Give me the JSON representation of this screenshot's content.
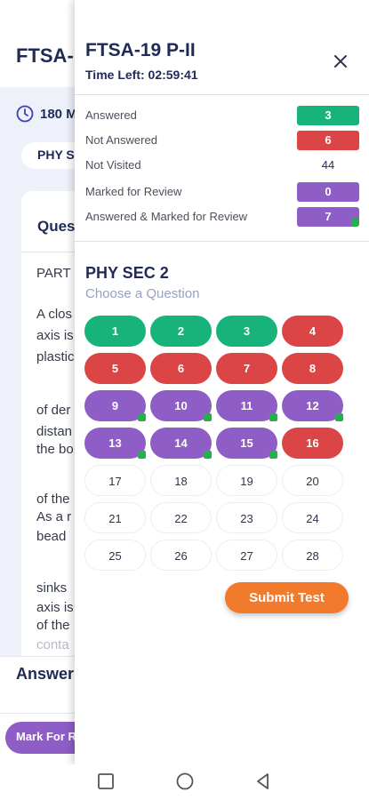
{
  "background": {
    "title": "FTSA-",
    "duration": "180 M",
    "section_pill": "PHY S",
    "card_title": "Ques",
    "text_lines": [
      "PART",
      "A clos",
      "axis is",
      "plastic",
      "of der",
      "distan",
      "the bo",
      "of the",
      "As a r",
      "bead",
      "sinks",
      "axis is",
      "of the",
      "conta"
    ],
    "answer_label": "Answer",
    "mark_button": "Mark For R"
  },
  "drawer": {
    "title": "FTSA-19 P-II",
    "timer": "Time Left: 02:59:41",
    "legend": [
      {
        "label": "Answered",
        "count": "3",
        "color": "#18b27b",
        "style": "filled"
      },
      {
        "label": "Not Answered",
        "count": "6",
        "color": "#dc4545",
        "style": "filled"
      },
      {
        "label": "Not Visited",
        "count": "44",
        "color": "#ffffff",
        "style": "outline"
      },
      {
        "label": "Marked for Review",
        "count": "0",
        "color": "#8e5ec6",
        "style": "filled"
      },
      {
        "label": "Answered & Marked for Review",
        "count": "7",
        "color": "#8e5ec6",
        "style": "filled-dot"
      }
    ],
    "section_title": "PHY SEC 2",
    "section_subtitle": "Choose a Question",
    "questions": [
      {
        "num": "1",
        "status": "answered"
      },
      {
        "num": "2",
        "status": "answered"
      },
      {
        "num": "3",
        "status": "answered"
      },
      {
        "num": "4",
        "status": "not-answered"
      },
      {
        "num": "5",
        "status": "not-answered"
      },
      {
        "num": "6",
        "status": "not-answered"
      },
      {
        "num": "7",
        "status": "not-answered"
      },
      {
        "num": "8",
        "status": "not-answered"
      },
      {
        "num": "9",
        "status": "answered-marked"
      },
      {
        "num": "10",
        "status": "answered-marked"
      },
      {
        "num": "11",
        "status": "answered-marked"
      },
      {
        "num": "12",
        "status": "answered-marked"
      },
      {
        "num": "13",
        "status": "answered-marked"
      },
      {
        "num": "14",
        "status": "answered-marked"
      },
      {
        "num": "15",
        "status": "answered-marked"
      },
      {
        "num": "16",
        "status": "not-answered"
      },
      {
        "num": "17",
        "status": "not-visited"
      },
      {
        "num": "18",
        "status": "not-visited"
      },
      {
        "num": "19",
        "status": "not-visited"
      },
      {
        "num": "20",
        "status": "not-visited"
      },
      {
        "num": "21",
        "status": "not-visited"
      },
      {
        "num": "22",
        "status": "not-visited"
      },
      {
        "num": "23",
        "status": "not-visited"
      },
      {
        "num": "24",
        "status": "not-visited"
      },
      {
        "num": "25",
        "status": "not-visited"
      },
      {
        "num": "26",
        "status": "not-visited"
      },
      {
        "num": "27",
        "status": "not-visited"
      },
      {
        "num": "28",
        "status": "not-visited"
      }
    ],
    "submit_label": "Submit Test",
    "icons": {
      "close": "close-icon"
    }
  },
  "nav": {
    "icons": [
      "recents-square-icon",
      "home-circle-icon",
      "back-triangle-icon"
    ]
  },
  "colors": {
    "answered": "#18b27b",
    "not_answered": "#dc4545",
    "marked": "#8e5ec6",
    "indicator": "#21b24a",
    "submit": "#f27a2c",
    "text_dark": "#1f2a56"
  }
}
